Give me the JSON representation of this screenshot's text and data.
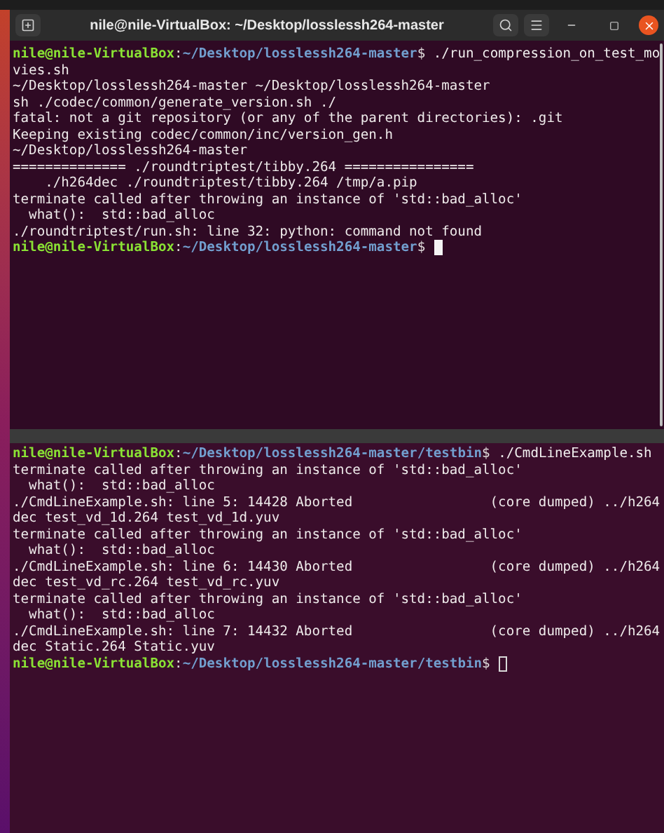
{
  "top_terminal": {
    "title": "nile@nile-VirtualBox: ~/Desktop/losslessh264-master",
    "cursor_focused": true,
    "lines": [
      {
        "kind": "prompt",
        "user": "nile@nile-VirtualBox",
        "separator": ":",
        "path": "~/Desktop/losslessh264-master",
        "symbol": "$",
        "command": " ./run_compression_on_test_mo"
      },
      {
        "kind": "output",
        "text": "vies.sh"
      },
      {
        "kind": "output",
        "text": "~/Desktop/losslessh264-master ~/Desktop/losslessh264-master"
      },
      {
        "kind": "output",
        "text": "sh ./codec/common/generate_version.sh ./"
      },
      {
        "kind": "output",
        "text": "fatal: not a git repository (or any of the parent directories): .git"
      },
      {
        "kind": "output",
        "text": "Keeping existing codec/common/inc/version_gen.h"
      },
      {
        "kind": "output",
        "text": "~/Desktop/losslessh264-master"
      },
      {
        "kind": "output",
        "text": "============== ./roundtriptest/tibby.264 ================"
      },
      {
        "kind": "output",
        "text": "    ./h264dec ./roundtriptest/tibby.264 /tmp/a.pip"
      },
      {
        "kind": "output",
        "text": "terminate called after throwing an instance of 'std::bad_alloc'"
      },
      {
        "kind": "output",
        "text": "  what():  std::bad_alloc"
      },
      {
        "kind": "output",
        "text": "./roundtriptest/run.sh: line 32: python: command not found"
      },
      {
        "kind": "prompt",
        "user": "nile@nile-VirtualBox",
        "separator": ":",
        "path": "~/Desktop/losslessh264-master",
        "symbol": "$",
        "cursor": true
      }
    ]
  },
  "bottom_terminal": {
    "cursor_focused": false,
    "lines": [
      {
        "kind": "prompt",
        "user": "nile@nile-VirtualBox",
        "separator": ":",
        "path": "~/Desktop/losslessh264-master/testbin",
        "symbol": "$",
        "command": " ./CmdLineExample.sh"
      },
      {
        "kind": "output",
        "text": "terminate called after throwing an instance of 'std::bad_alloc'"
      },
      {
        "kind": "output",
        "text": "  what():  std::bad_alloc"
      },
      {
        "kind": "output",
        "text": "./CmdLineExample.sh: line 5: 14428 Aborted                 (core dumped) ../h264"
      },
      {
        "kind": "output",
        "text": "dec test_vd_1d.264 test_vd_1d.yuv"
      },
      {
        "kind": "output",
        "text": "terminate called after throwing an instance of 'std::bad_alloc'"
      },
      {
        "kind": "output",
        "text": "  what():  std::bad_alloc"
      },
      {
        "kind": "output",
        "text": "./CmdLineExample.sh: line 6: 14430 Aborted                 (core dumped) ../h264"
      },
      {
        "kind": "output",
        "text": "dec test_vd_rc.264 test_vd_rc.yuv"
      },
      {
        "kind": "output",
        "text": "terminate called after throwing an instance of 'std::bad_alloc'"
      },
      {
        "kind": "output",
        "text": "  what():  std::bad_alloc"
      },
      {
        "kind": "output",
        "text": "./CmdLineExample.sh: line 7: 14432 Aborted                 (core dumped) ../h264"
      },
      {
        "kind": "output",
        "text": "dec Static.264 Static.yuv"
      },
      {
        "kind": "prompt",
        "user": "nile@nile-VirtualBox",
        "separator": ":",
        "path": "~/Desktop/losslessh264-master/testbin",
        "symbol": "$",
        "cursor": true
      }
    ]
  }
}
